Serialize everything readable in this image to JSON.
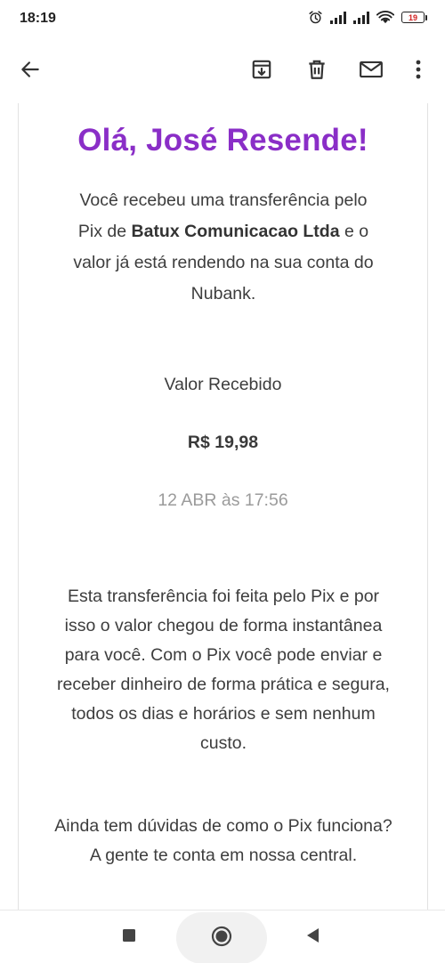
{
  "status_bar": {
    "time": "18:19",
    "battery_level": "19",
    "icons": [
      "alarm-icon",
      "signal-icon",
      "signal-icon",
      "wifi-icon",
      "battery-icon"
    ]
  },
  "toolbar": {
    "icons": [
      "back-arrow-icon",
      "archive-icon",
      "delete-icon",
      "mail-icon",
      "more-vert-icon"
    ]
  },
  "email": {
    "greeting": "Olá, José Resende!",
    "intro_part1": "Você recebeu uma transferência pelo Pix de ",
    "sender": "Batux Comunicacao Ltda",
    "intro_part2": " e o valor já está rendendo na sua conta do Nubank.",
    "value_label": "Valor Recebido",
    "value_amount": "R$ 19,98",
    "date": "12 ABR às 17:56",
    "info": "Esta transferência foi feita pelo Pix e por isso o valor chegou de forma instantânea para você. Com o Pix você pode enviar e receber dinheiro de forma prática e segura, todos os dias e horários e sem nenhum custo.",
    "help_line1": "Ainda tem dúvidas de como o Pix funciona?",
    "help_line2": "A gente te conta em nossa central."
  },
  "colors": {
    "accent": "#8a2ec7",
    "text": "#3d3d3d",
    "muted": "#9b9b9b",
    "battery_low": "#d21f1f"
  },
  "nav_bar": {
    "icons": [
      "recents-square-icon",
      "home-circle-icon",
      "back-triangle-icon"
    ]
  }
}
